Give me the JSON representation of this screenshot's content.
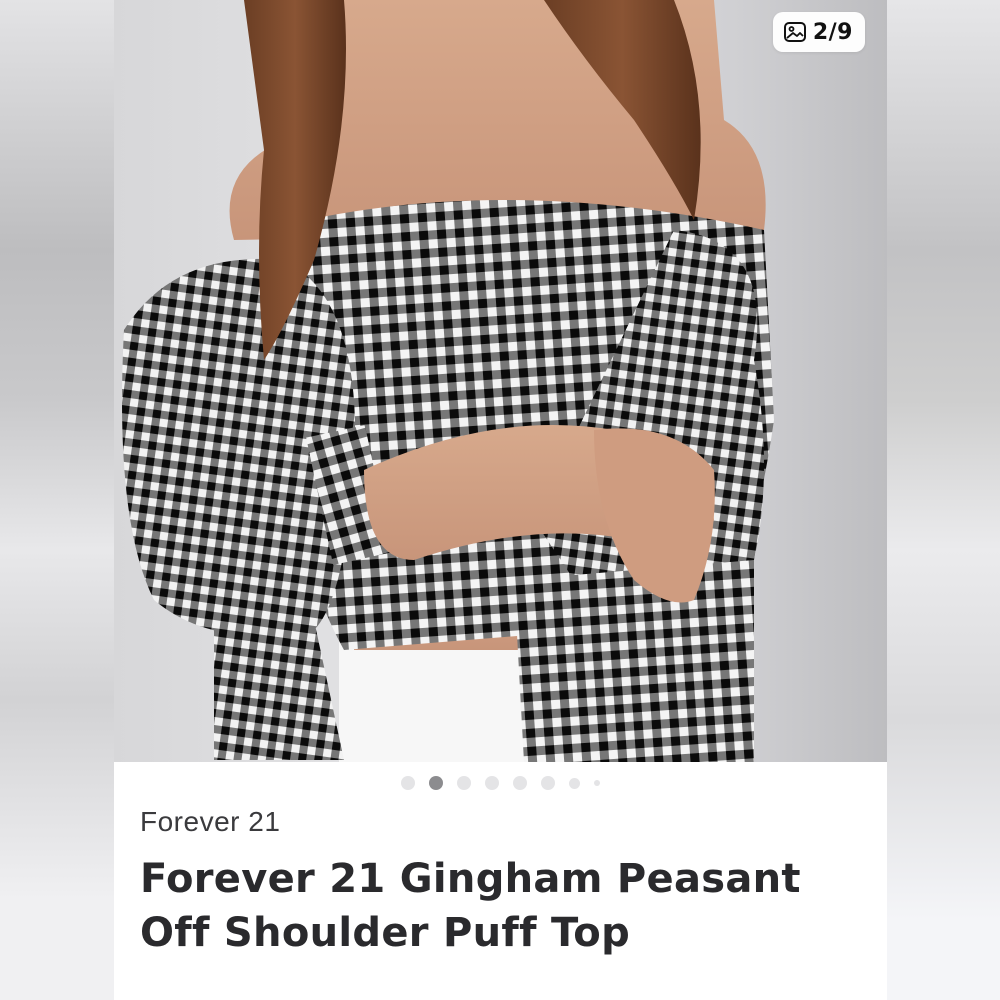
{
  "gallery": {
    "counter": "2/9",
    "counter_icon": "image-gallery-icon",
    "dot_count": 8,
    "active_index": 1
  },
  "listing": {
    "brand": "Forever 21",
    "title": "Forever 21 Gingham Peasant Off Shoulder Puff Top"
  },
  "colors": {
    "gingham_dark": "#111111",
    "gingham_light": "#f4f4f4",
    "dot_active": "#8c8c8f",
    "dot_inactive": "#e4e4e6"
  }
}
